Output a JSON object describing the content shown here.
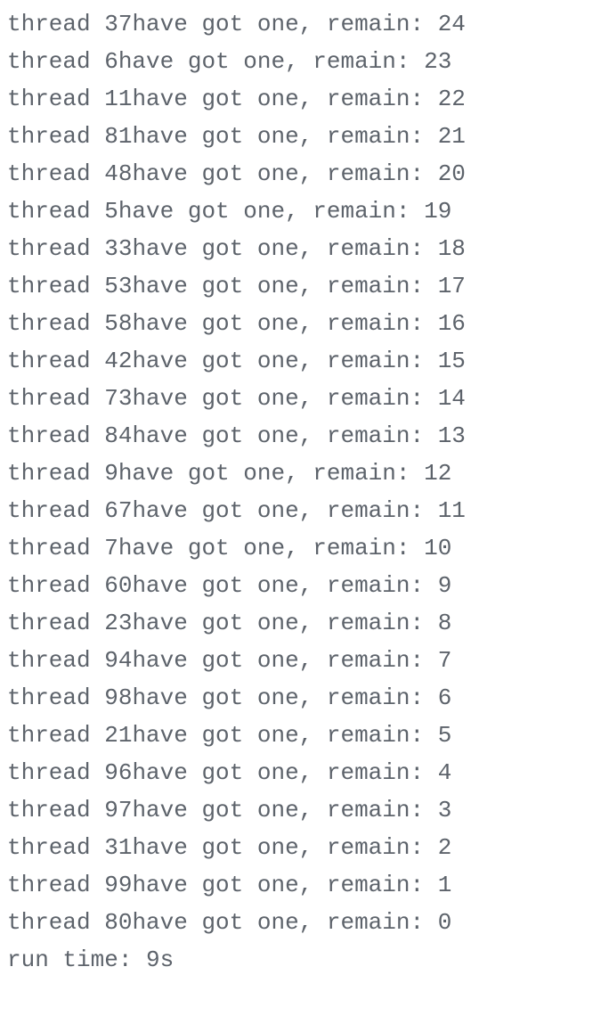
{
  "console": {
    "template_prefix": "thread ",
    "template_middle": "have got one, remain: ",
    "entries": [
      {
        "thread": 37,
        "remain": 24
      },
      {
        "thread": 6,
        "remain": 23
      },
      {
        "thread": 11,
        "remain": 22
      },
      {
        "thread": 81,
        "remain": 21
      },
      {
        "thread": 48,
        "remain": 20
      },
      {
        "thread": 5,
        "remain": 19
      },
      {
        "thread": 33,
        "remain": 18
      },
      {
        "thread": 53,
        "remain": 17
      },
      {
        "thread": 58,
        "remain": 16
      },
      {
        "thread": 42,
        "remain": 15
      },
      {
        "thread": 73,
        "remain": 14
      },
      {
        "thread": 84,
        "remain": 13
      },
      {
        "thread": 9,
        "remain": 12
      },
      {
        "thread": 67,
        "remain": 11
      },
      {
        "thread": 7,
        "remain": 10
      },
      {
        "thread": 60,
        "remain": 9
      },
      {
        "thread": 23,
        "remain": 8
      },
      {
        "thread": 94,
        "remain": 7
      },
      {
        "thread": 98,
        "remain": 6
      },
      {
        "thread": 21,
        "remain": 5
      },
      {
        "thread": 96,
        "remain": 4
      },
      {
        "thread": 97,
        "remain": 3
      },
      {
        "thread": 31,
        "remain": 2
      },
      {
        "thread": 99,
        "remain": 1
      },
      {
        "thread": 80,
        "remain": 0
      }
    ],
    "footer_label": "run time: ",
    "footer_value": "9s"
  }
}
